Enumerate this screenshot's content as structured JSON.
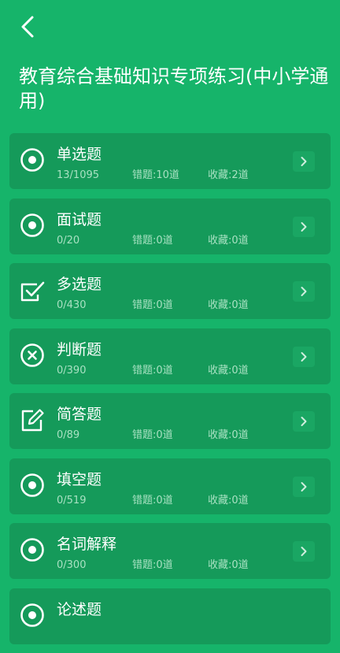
{
  "header": {
    "back_icon": "chevron-left-icon",
    "title": "教育综合基础知识专项练习(中小学通用)"
  },
  "practice_items": [
    {
      "name": "单选题",
      "progress": "13/1095",
      "wrong": "错题:10道",
      "favorites": "收藏:2道",
      "icon": "radio-target-icon"
    },
    {
      "name": "面试题",
      "progress": "0/20",
      "wrong": "错题:0道",
      "favorites": "收藏:0道",
      "icon": "radio-target-icon"
    },
    {
      "name": "多选题",
      "progress": "0/430",
      "wrong": "错题:0道",
      "favorites": "收藏:0道",
      "icon": "checkbox-icon"
    },
    {
      "name": "判断题",
      "progress": "0/390",
      "wrong": "错题:0道",
      "favorites": "收藏:0道",
      "icon": "circle-x-icon"
    },
    {
      "name": "简答题",
      "progress": "0/89",
      "wrong": "错题:0道",
      "favorites": "收藏:0道",
      "icon": "edit-icon"
    },
    {
      "name": "填空题",
      "progress": "0/519",
      "wrong": "错题:0道",
      "favorites": "收藏:0道",
      "icon": "radio-target-icon"
    },
    {
      "name": "名词解释",
      "progress": "0/300",
      "wrong": "错题:0道",
      "favorites": "收藏:0道",
      "icon": "radio-target-icon"
    },
    {
      "name": "论述题",
      "icon": "radio-target-icon"
    }
  ],
  "colors": {
    "background": "#16b46a",
    "card": "#159a5a",
    "meta_text": "#a8e1c2"
  }
}
